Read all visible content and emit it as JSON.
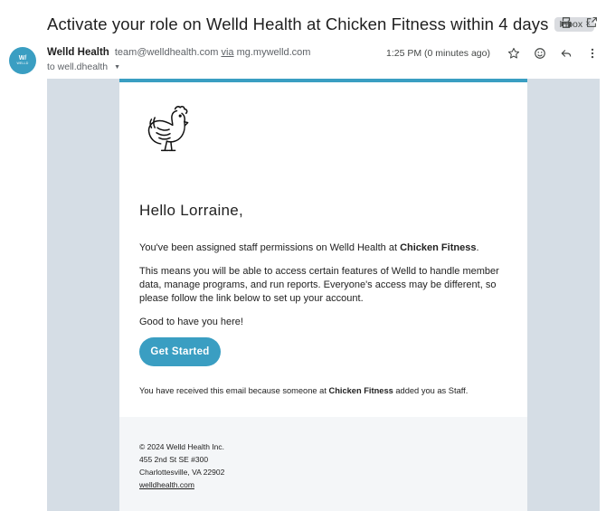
{
  "subject": "Activate your role on Welld Health at Chicken Fitness within 4 days",
  "label": {
    "text": "Inbox",
    "remove": "×"
  },
  "avatar": {
    "line1": "W/",
    "line2": "WELLD"
  },
  "sender": {
    "name": "Welld Health",
    "email": "team@welldhealth.com",
    "via_word": "via",
    "via_domain": "mg.mywelld.com",
    "to": "to well.dhealth",
    "time": "1:25 PM (0 minutes ago)"
  },
  "icons": {
    "print": "print-icon",
    "popout": "open-in-new-icon",
    "star": "star-icon",
    "emoji": "emoji-icon",
    "reply": "reply-icon",
    "more": "more-vert-icon"
  },
  "email": {
    "greeting": "Hello Lorraine,",
    "p1_pre": "You've been assigned staff permissions on Welld Health at ",
    "p1_bold": "Chicken Fitness",
    "p1_post": ".",
    "p2": "This means you will be able to access certain features of Welld to handle member data, manage programs, and run reports. Everyone's access may be different, so please follow the link below to set up your account.",
    "p3": "Good to have you here!",
    "cta": "Get Started",
    "reason_pre": "You have received this email because someone at ",
    "reason_bold": "Chicken Fitness",
    "reason_post": " added you as Staff."
  },
  "footer": {
    "copyright": "© 2024 Welld Health Inc.",
    "address1": "455 2nd St SE #300",
    "address2": "Charlottesville, VA 22902",
    "link": "welldhealth.com"
  },
  "colors": {
    "accent": "#3a9ec2",
    "background": "#d5dde5"
  }
}
